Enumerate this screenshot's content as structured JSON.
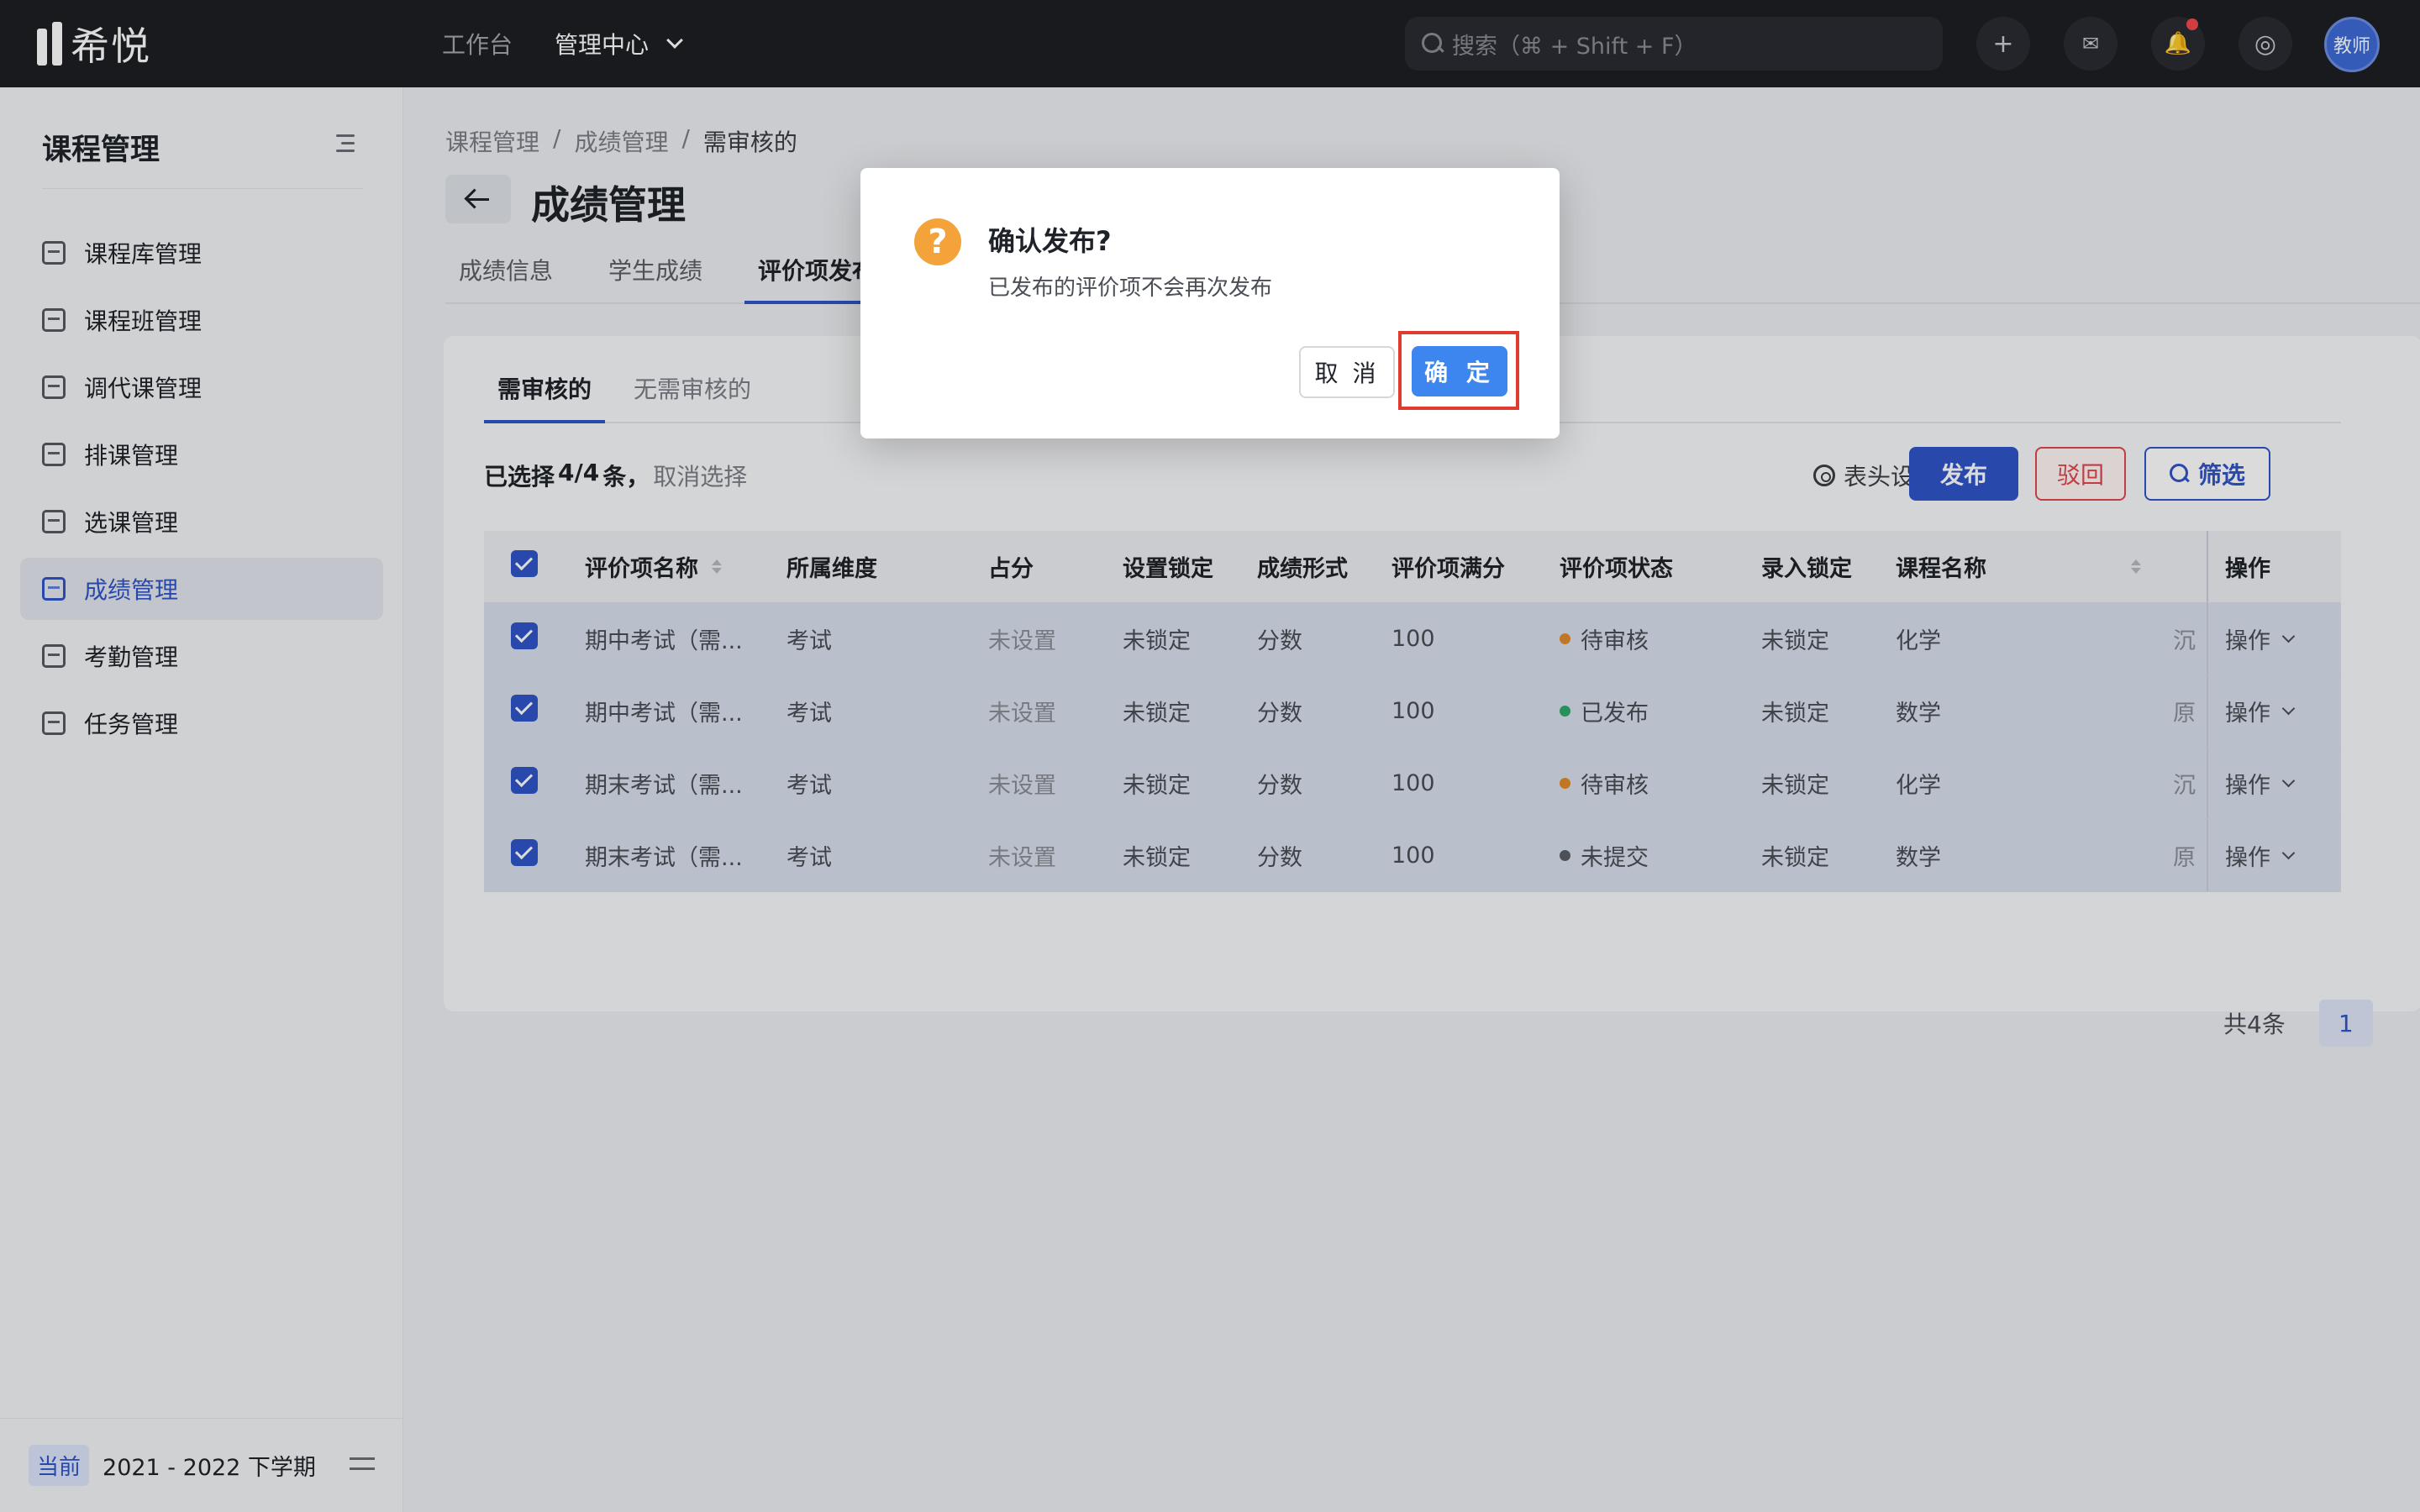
{
  "app": {
    "logo_text": "希悦"
  },
  "topnav": {
    "items": [
      "工作台"
    ],
    "active": "管理中心"
  },
  "search": {
    "placeholder": "搜索（⌘ + Shift + F）"
  },
  "top_icons": {
    "plus": "+",
    "messages": "✉",
    "bell": "🔔",
    "help": "◎"
  },
  "user": {
    "avatar_label": "教师"
  },
  "sidebar": {
    "title": "课程管理",
    "items": [
      {
        "label": "课程库管理",
        "icon": "stack-icon"
      },
      {
        "label": "课程班管理",
        "icon": "class-icon"
      },
      {
        "label": "调代课管理",
        "icon": "swap-doc-icon"
      },
      {
        "label": "排课管理",
        "icon": "schedule-icon"
      },
      {
        "label": "选课管理",
        "icon": "check-doc-icon"
      },
      {
        "label": "成绩管理",
        "icon": "chart-doc-icon"
      },
      {
        "label": "考勤管理",
        "icon": "calendar-icon"
      },
      {
        "label": "任务管理",
        "icon": "tasklist-icon"
      }
    ],
    "active_index": 5,
    "footer": {
      "tag": "当前",
      "term": "2021 - 2022 下学期"
    }
  },
  "breadcrumb": [
    "课程管理",
    "/",
    "成绩管理",
    "/",
    "需审核的"
  ],
  "page": {
    "title": "成绩管理"
  },
  "tabs": [
    "成绩信息",
    "学生成绩",
    "评价项发布"
  ],
  "subtabs": [
    "需审核的",
    "无需审核的"
  ],
  "selection": {
    "prefix": "已选择 ",
    "count": "4/4",
    "suffix": " 条，",
    "clear": "取消选择"
  },
  "toolbar": {
    "header_setting": "表头设置",
    "publish": "发布",
    "reject": "驳回",
    "filter": "筛选"
  },
  "table": {
    "columns": [
      "评价项名称",
      "所属维度",
      "占分",
      "设置锁定",
      "成绩形式",
      "评价项满分",
      "评价项状态",
      "录入锁定",
      "课程名称",
      "操作"
    ],
    "rows": [
      {
        "name": "期中考试（需...",
        "dimension": "考试",
        "score": "未设置",
        "lock": "未锁定",
        "form": "分数",
        "full": "100",
        "status": "待审核",
        "status_color": "#e08a2a",
        "entry_lock": "未锁定",
        "course": "化学",
        "cut": "沉",
        "action": "操作"
      },
      {
        "name": "期中考试（需...",
        "dimension": "考试",
        "score": "未设置",
        "lock": "未锁定",
        "form": "分数",
        "full": "100",
        "status": "已发布",
        "status_color": "#2fa86b",
        "entry_lock": "未锁定",
        "course": "数学",
        "cut": "原",
        "action": "操作"
      },
      {
        "name": "期末考试（需...",
        "dimension": "考试",
        "score": "未设置",
        "lock": "未锁定",
        "form": "分数",
        "full": "100",
        "status": "待审核",
        "status_color": "#e08a2a",
        "entry_lock": "未锁定",
        "course": "化学",
        "cut": "沉",
        "action": "操作"
      },
      {
        "name": "期末考试（需...",
        "dimension": "考试",
        "score": "未设置",
        "lock": "未锁定",
        "form": "分数",
        "full": "100",
        "status": "未提交",
        "status_color": "#5a5e65",
        "entry_lock": "未锁定",
        "course": "数学",
        "cut": "原",
        "action": "操作"
      }
    ]
  },
  "pagination": {
    "total": "共4条",
    "current": "1"
  },
  "modal": {
    "icon": "?",
    "title": "确认发布?",
    "description": "已发布的评价项不会再次发布",
    "cancel": "取 消",
    "ok": "确 定"
  },
  "colors": {
    "accent": "#2f54c8",
    "ok_button": "#3d86f0",
    "warning": "#f3a33a",
    "danger": "#e0474c",
    "highlight_box": "#e03b2f"
  }
}
